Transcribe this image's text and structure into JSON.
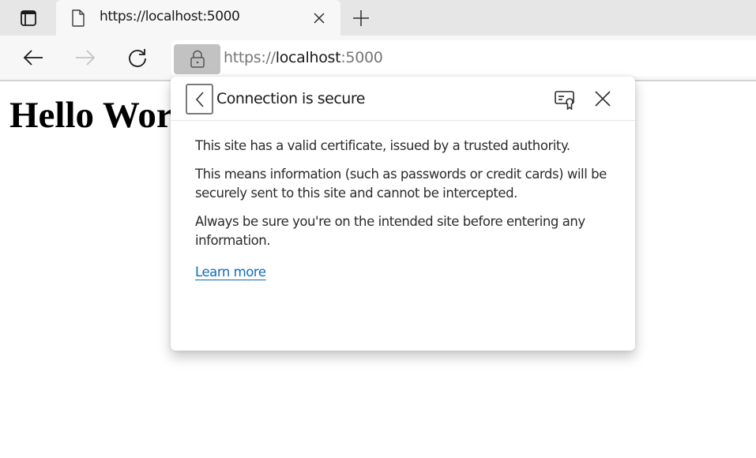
{
  "browser": {
    "tab": {
      "title": "https://localhost:5000",
      "icon": "page-icon"
    },
    "tab_actions_icon": "tab-actions-icon",
    "new_tab_icon": "plus-icon",
    "close_tab_icon": "close-icon"
  },
  "toolbar": {
    "back_icon": "arrow-left-icon",
    "forward_icon": "arrow-right-icon",
    "forward_enabled": false,
    "reload_icon": "reload-icon",
    "address": {
      "scheme": "https://",
      "host": "localhost",
      "port": ":5000",
      "lock_icon": "lock-icon"
    }
  },
  "page": {
    "heading": "Hello World"
  },
  "flyout": {
    "title": "Connection is secure",
    "back_icon": "chevron-left-icon",
    "certificate_icon": "certificate-icon",
    "close_icon": "close-icon",
    "paragraphs": [
      "This site has a valid certificate, issued by a trusted authority.",
      "This means information (such as passwords or credit cards) will be securely sent to this site and cannot be intercepted.",
      "Always be sure you're on the intended site before entering any information."
    ],
    "learn_more": "Learn more",
    "link_color": "#0f6cbd"
  }
}
